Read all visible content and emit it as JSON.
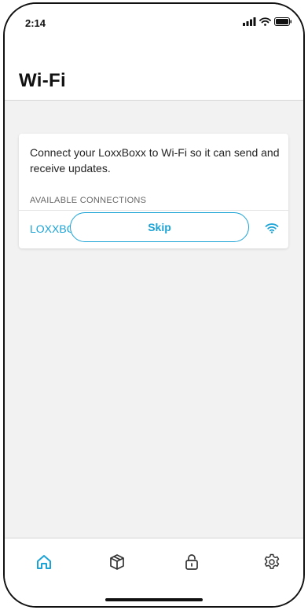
{
  "status_bar": {
    "time": "2:14",
    "icons": [
      "signal-icon",
      "wifi-icon",
      "battery-icon"
    ]
  },
  "header": {
    "title": "Wi-Fi"
  },
  "card": {
    "description": "Connect your LoxxBoxx to Wi-Fi so it can send and receive updates.",
    "section_header": "AVAILABLE CONNECTIONS",
    "connections": [
      {
        "name": "LOXXBOXX-2",
        "icon": "wifi-icon"
      }
    ]
  },
  "actions": {
    "skip_label": "Skip"
  },
  "tab_bar": {
    "tabs": [
      {
        "icon": "home-icon",
        "active": true
      },
      {
        "icon": "package-icon",
        "active": false
      },
      {
        "icon": "lock-icon",
        "active": false
      },
      {
        "icon": "gear-icon",
        "active": false
      }
    ]
  },
  "colors": {
    "accent": "#1ba3d6",
    "background": "#f2f2f2",
    "text": "#222222",
    "muted": "#666666",
    "inactive_icon": "#333333"
  }
}
